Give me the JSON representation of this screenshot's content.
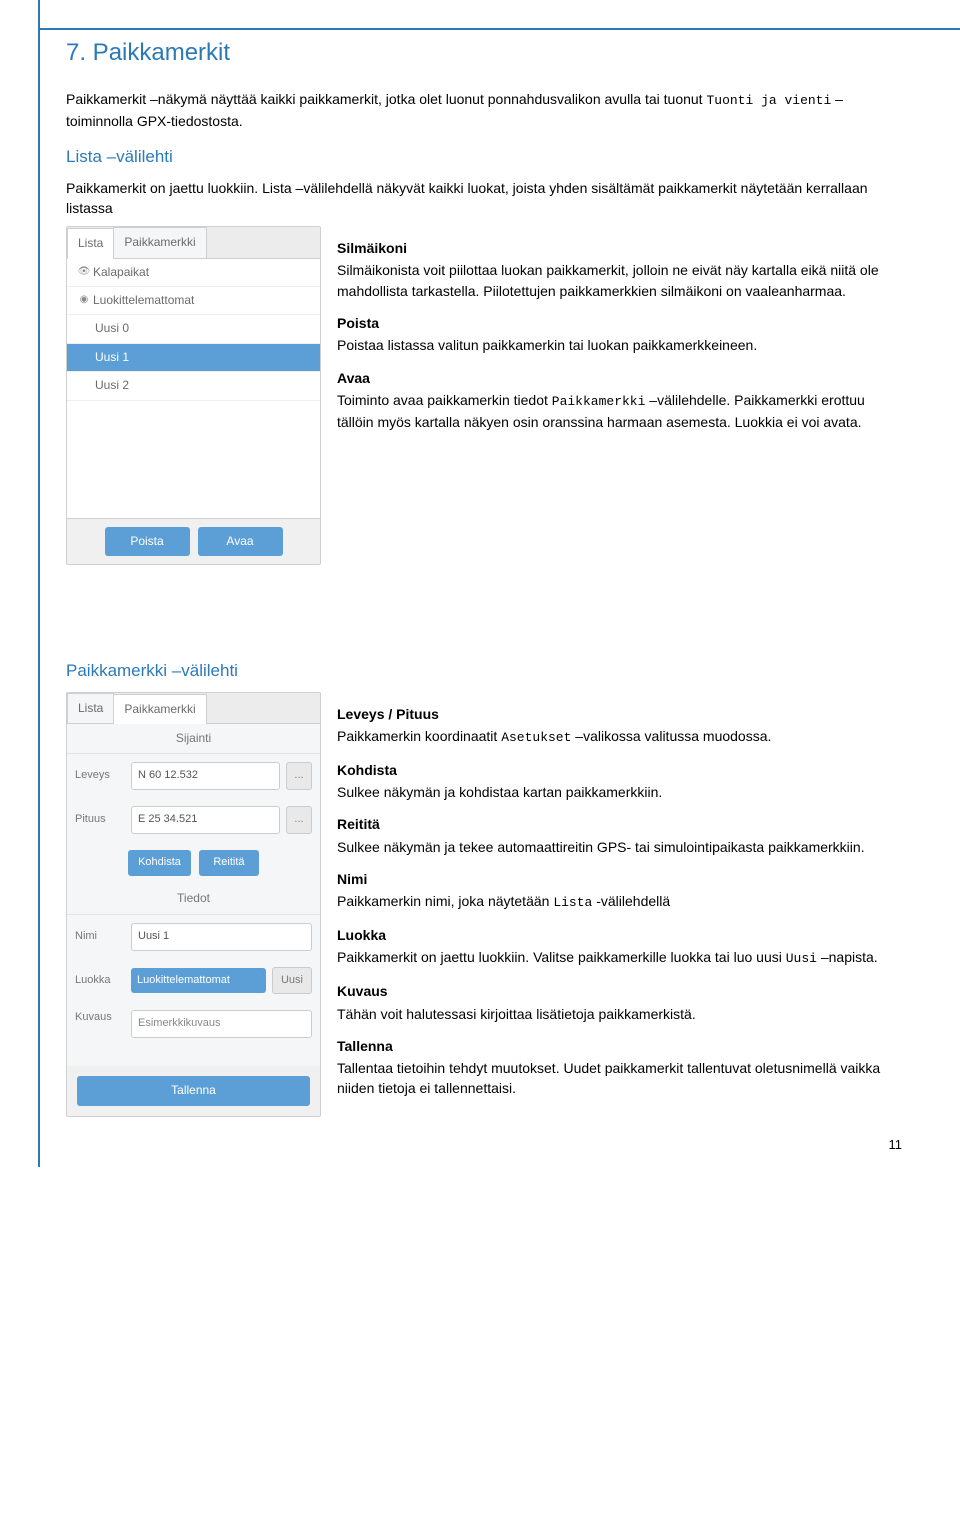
{
  "page_number": "11",
  "section": {
    "title": "7. Paikkamerkit",
    "intro_part1": "Paikkamerkit –näkymä näyttää kaikki paikkamerkit, jotka olet luonut ponnahdusvalikon avulla tai tuonut ",
    "intro_mono": "Tuonti ja vienti",
    "intro_part2": " –toiminnolla GPX-tiedostosta."
  },
  "lista": {
    "heading": "Lista –välilehti",
    "intro": "Paikkamerkit on jaettu luokkiin. Lista –välilehdellä näkyvät kaikki luokat, joista yhden sisältämät paikkamerkit näytetään kerrallaan listassa",
    "silmaikoni_h": "Silmäikoni",
    "silmaikoni_p": "Silmäikonista voit piilottaa luokan paikkamerkit, jolloin ne eivät näy kartalla eikä niitä ole mahdollista tarkastella. Piilotettujen paikkamerkkien silmäikoni on vaaleanharmaa.",
    "poista_h": "Poista",
    "poista_p": "Poistaa listassa valitun paikkamerkin tai luokan paikkamerkkeineen.",
    "avaa_h": "Avaa",
    "avaa_p1a": "Toiminto avaa paikkamerkin tiedot ",
    "avaa_p1m": "Paikkamerkki",
    "avaa_p1b": " –välilehdelle. Paikkamerkki erottuu tällöin myös kartalla näkyen osin oranssina harmaan asemesta. Luokkia ei voi avata."
  },
  "panel1": {
    "tab_lista": "Lista",
    "tab_paikkamerkki": "Paikkamerkki",
    "rows": {
      "kalapaikat": "Kalapaikat",
      "luokittelemattomat": "Luokittelemattomat",
      "uusi0": "Uusi 0",
      "uusi1": "Uusi 1",
      "uusi2": "Uusi 2"
    },
    "btn_poista": "Poista",
    "btn_avaa": "Avaa"
  },
  "paikkamerkki": {
    "heading": "Paikkamerkki –välilehti",
    "leveys_h": "Leveys / Pituus",
    "leveys_p1": "Paikkamerkin koordinaatit ",
    "leveys_m": "Asetukset",
    "leveys_p2": " –valikossa valitussa muodossa.",
    "kohdista_h": "Kohdista",
    "kohdista_p": "Sulkee näkymän ja kohdistaa kartan paikkamerkkiin.",
    "reitita_h": "Reititä",
    "reitita_p": "Sulkee näkymän ja tekee automaattireitin GPS- tai simulointipaikasta paikkamerkkiin.",
    "nimi_h": "Nimi",
    "nimi_p1": "Paikkamerkin nimi, joka näytetään ",
    "nimi_m": "Lista",
    "nimi_p2": " -välilehdellä",
    "luokka_h": "Luokka",
    "luokka_p1": "Paikkamerkit on jaettu luokkiin. Valitse paikkamerkille luokka tai luo uusi ",
    "luokka_m": "Uusi",
    "luokka_p2": " –napista.",
    "kuvaus_h": "Kuvaus",
    "kuvaus_p": "Tähän voit halutessasi kirjoittaa lisätietoja paikkamerkistä.",
    "tallenna_h": "Tallenna",
    "tallenna_p": "Tallentaa tietoihin tehdyt muutokset. Uudet paikkamerkit tallentuvat oletusnimellä vaikka niiden tietoja ei tallennettaisi."
  },
  "panel2": {
    "tab_lista": "Lista",
    "tab_paikkamerkki": "Paikkamerkki",
    "sijainti": "Sijainti",
    "leveys_label": "Leveys",
    "leveys_val": "N 60 12.532",
    "pituus_label": "Pituus",
    "pituus_val": "E 25 34.521",
    "kohdista": "Kohdista",
    "reitita": "Reititä",
    "tiedot": "Tiedot",
    "nimi_label": "Nimi",
    "nimi_val": "Uusi 1",
    "luokka_label": "Luokka",
    "luokka_val": "Luokittelemattomat",
    "uusi": "Uusi",
    "kuvaus_label": "Kuvaus",
    "kuvaus_val": "Esimerkkikuvaus",
    "tallenna": "Tallenna",
    "dots": "..."
  }
}
